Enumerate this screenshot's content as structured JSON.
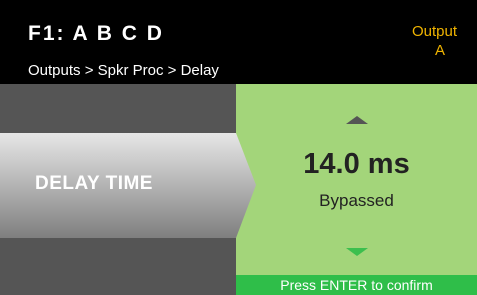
{
  "header": {
    "title": "F1: A B C D",
    "breadcrumb": "Outputs > Spkr Proc > Delay",
    "output_label": "Output",
    "output_channel": "A"
  },
  "parameter": {
    "label": "DELAY TIME",
    "value": "14.0 ms",
    "status": "Bypassed",
    "up_icon": "triangle-up",
    "down_icon": "triangle-down"
  },
  "footer": {
    "confirm_text": "Press ENTER to confirm"
  },
  "colors": {
    "header_bg": "#000000",
    "accent_orange": "#f0b400",
    "panel_gray": "#555555",
    "value_green": "#a3d57a",
    "confirm_green": "#2fbe49"
  }
}
